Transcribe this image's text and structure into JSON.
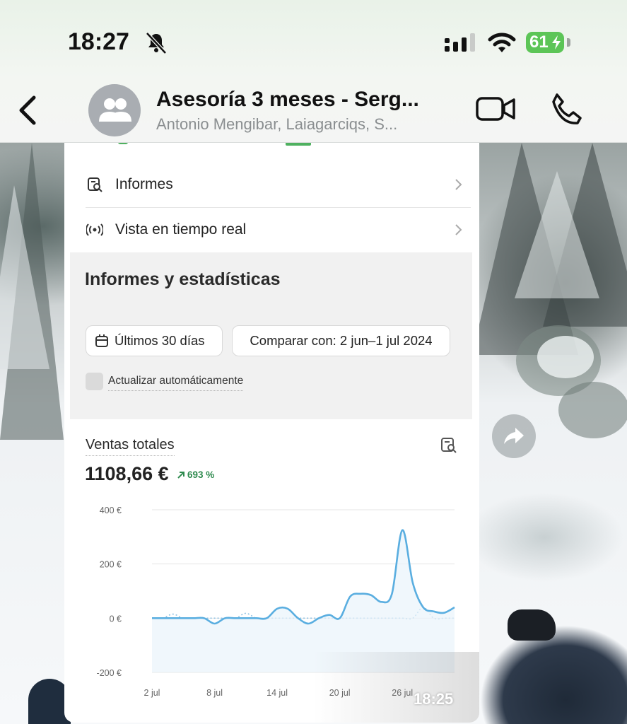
{
  "status_bar": {
    "time": "18:27",
    "battery": "61"
  },
  "chat_header": {
    "title": "Asesoría 3 meses - Serg...",
    "participants": "Antonio Mengibar, Laiagarciqs, S..."
  },
  "shared_image": {
    "menu_items": [
      {
        "label": "Informes",
        "icon": "report-icon"
      },
      {
        "label": "Vista en tiempo real",
        "icon": "live-broadcast-icon"
      }
    ],
    "section_title": "Informes y estadísticas",
    "date_range_button": "Últimos 30 días",
    "compare_button": "Comparar con: 2 jun–1 jul 2024",
    "auto_update_label": "Actualizar automáticamente",
    "chart_card": {
      "title": "Ventas totales",
      "total": "1108,66 €",
      "change": "693 %"
    }
  },
  "message_time": "18:25",
  "colors": {
    "line": "#5aaee0",
    "comparison_line": "#8fc2e3",
    "positive": "#2e8a4e",
    "battery": "#5cc557"
  },
  "chart_data": {
    "type": "line",
    "title": "Ventas totales",
    "xlabel": "",
    "ylabel": "",
    "ylim": [
      -200,
      400
    ],
    "yticks": [
      400,
      200,
      0,
      -200
    ],
    "ytick_labels": [
      "400 €",
      "200 €",
      "0 €",
      "-200 €"
    ],
    "xtick_labels": [
      "2 jul",
      "8 jul",
      "14 jul",
      "20 jul",
      "26 jul"
    ],
    "xtick_positions": [
      0,
      6,
      12,
      18,
      24
    ],
    "grid": true,
    "series": [
      {
        "x": [
          0,
          1,
          2,
          3,
          4,
          5,
          6,
          7,
          8,
          9,
          10,
          11,
          12,
          13,
          14,
          15,
          16,
          17,
          18,
          19,
          20,
          21,
          22,
          23,
          24,
          25,
          26,
          27,
          28,
          29
        ],
        "values": [
          0,
          0,
          0,
          0,
          0,
          0,
          -20,
          0,
          0,
          0,
          0,
          0,
          35,
          35,
          0,
          -20,
          0,
          12,
          0,
          80,
          90,
          85,
          60,
          90,
          325,
          130,
          40,
          25,
          20,
          40
        ]
      },
      {
        "x": [
          0,
          1,
          2,
          3,
          4,
          5,
          6,
          7,
          8,
          9,
          10,
          11,
          12,
          13,
          14,
          15,
          16,
          17,
          18,
          19,
          20,
          21,
          22,
          23,
          24,
          25,
          26,
          27,
          28,
          29
        ],
        "values": [
          0,
          0,
          15,
          0,
          0,
          0,
          0,
          0,
          0,
          18,
          0,
          0,
          0,
          0,
          0,
          0,
          0,
          0,
          0,
          0,
          0,
          0,
          0,
          0,
          0,
          0,
          40,
          0,
          0,
          0
        ]
      }
    ]
  }
}
